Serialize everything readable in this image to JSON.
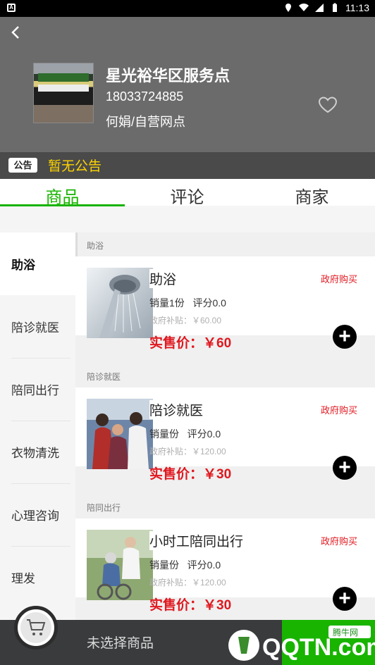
{
  "status_bar": {
    "time": "11:13"
  },
  "store": {
    "name": "星光裕华区服务点",
    "phone": "18033724885",
    "owner": "何娟/自营网点"
  },
  "notice": {
    "badge": "公告",
    "text": "暂无公告"
  },
  "tabs": [
    {
      "label": "商品",
      "active": true
    },
    {
      "label": "评论",
      "active": false
    },
    {
      "label": "商家",
      "active": false
    }
  ],
  "sidebar": {
    "items": [
      {
        "label": "助浴",
        "active": true
      },
      {
        "label": "陪诊就医",
        "active": false
      },
      {
        "label": "陪同出行",
        "active": false
      },
      {
        "label": "衣物清洗",
        "active": false
      },
      {
        "label": "心理咨询",
        "active": false
      },
      {
        "label": "理发",
        "active": false
      }
    ]
  },
  "sections": [
    {
      "header": "助浴",
      "product": {
        "name": "助浴",
        "sales": "销量1份",
        "rating": "评分0.0",
        "subsidy": "政府补贴：￥60.00",
        "price": "实售价：￥60",
        "tag": "政府购买"
      }
    },
    {
      "header": "陪诊就医",
      "product": {
        "name": "陪诊就医",
        "sales": "销量份",
        "rating": "评分0.0",
        "subsidy": "政府补贴：￥120.00",
        "price": "实售价：￥30",
        "tag": "政府购买"
      }
    },
    {
      "header": "陪同出行",
      "product": {
        "name": "小时工陪同出行",
        "sales": "销量份",
        "rating": "评分0.0",
        "subsidy": "政府补贴：￥120.00",
        "price": "实售价：￥30",
        "tag": "政府购买"
      }
    }
  ],
  "bottom": {
    "empty_text": "未选择商品",
    "watermark_main": "QQTN.com",
    "watermark_badge": "腾牛网"
  },
  "colors": {
    "accent": "#18b400",
    "price": "#e0181f",
    "notice": "#ffd400"
  },
  "icons": {
    "back": "chevron-left-icon",
    "favorite": "heart-icon",
    "add": "plus-circle-icon",
    "cart": "cart-icon"
  }
}
